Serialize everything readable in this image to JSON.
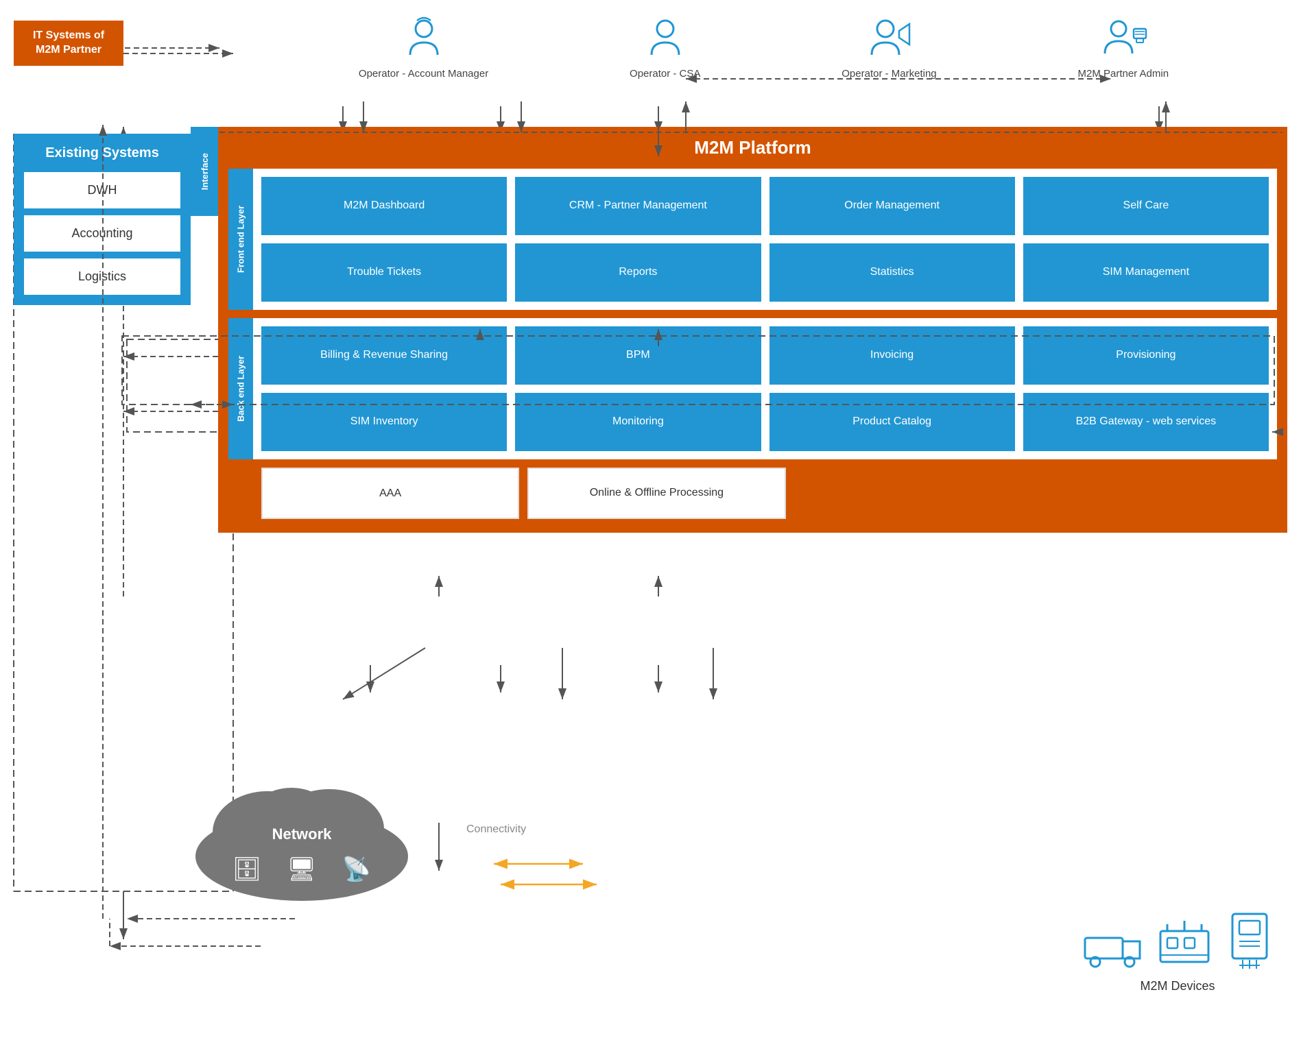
{
  "itSystems": {
    "label": "IT Systems\nof M2M Partner"
  },
  "existingSystems": {
    "title": "Existing\nSystems",
    "items": [
      "DWH",
      "Accounting",
      "Logistics"
    ]
  },
  "personas": [
    {
      "name": "Operator\n- Account Manager",
      "icon": "operator-account"
    },
    {
      "name": "Operator\n- CSA",
      "icon": "operator-csa"
    },
    {
      "name": "Operator\n- Marketing",
      "icon": "operator-marketing"
    },
    {
      "name": "M2M Partner\nAdmin",
      "icon": "m2m-admin"
    }
  ],
  "interfaceLabel": "Interface",
  "m2mPlatform": {
    "title": "M2M Platform",
    "frontEndLabel": "Front end Layer",
    "backEndLabel": "Back end Layer",
    "frontEndModules": [
      "M2M\nDashboard",
      "CRM - Partner\nManagement",
      "Order\nManagement",
      "Self Care",
      "Trouble\nTickets",
      "Reports",
      "Statistics",
      "SIM Management"
    ],
    "backEndModules": [
      "Billing &\nRevenue Sharing",
      "BPM",
      "Invoicing",
      "Provisioning",
      "SIM Inventory",
      "Monitoring",
      "Product Catalog",
      "B2B Gateway\n- web services"
    ],
    "aaaModules": [
      "AAA",
      "Online & Offline\nProcessing"
    ]
  },
  "network": {
    "label": "Network",
    "connectivityLabel": "Connectivity"
  },
  "m2mDevices": {
    "label": "M2M Devices"
  }
}
